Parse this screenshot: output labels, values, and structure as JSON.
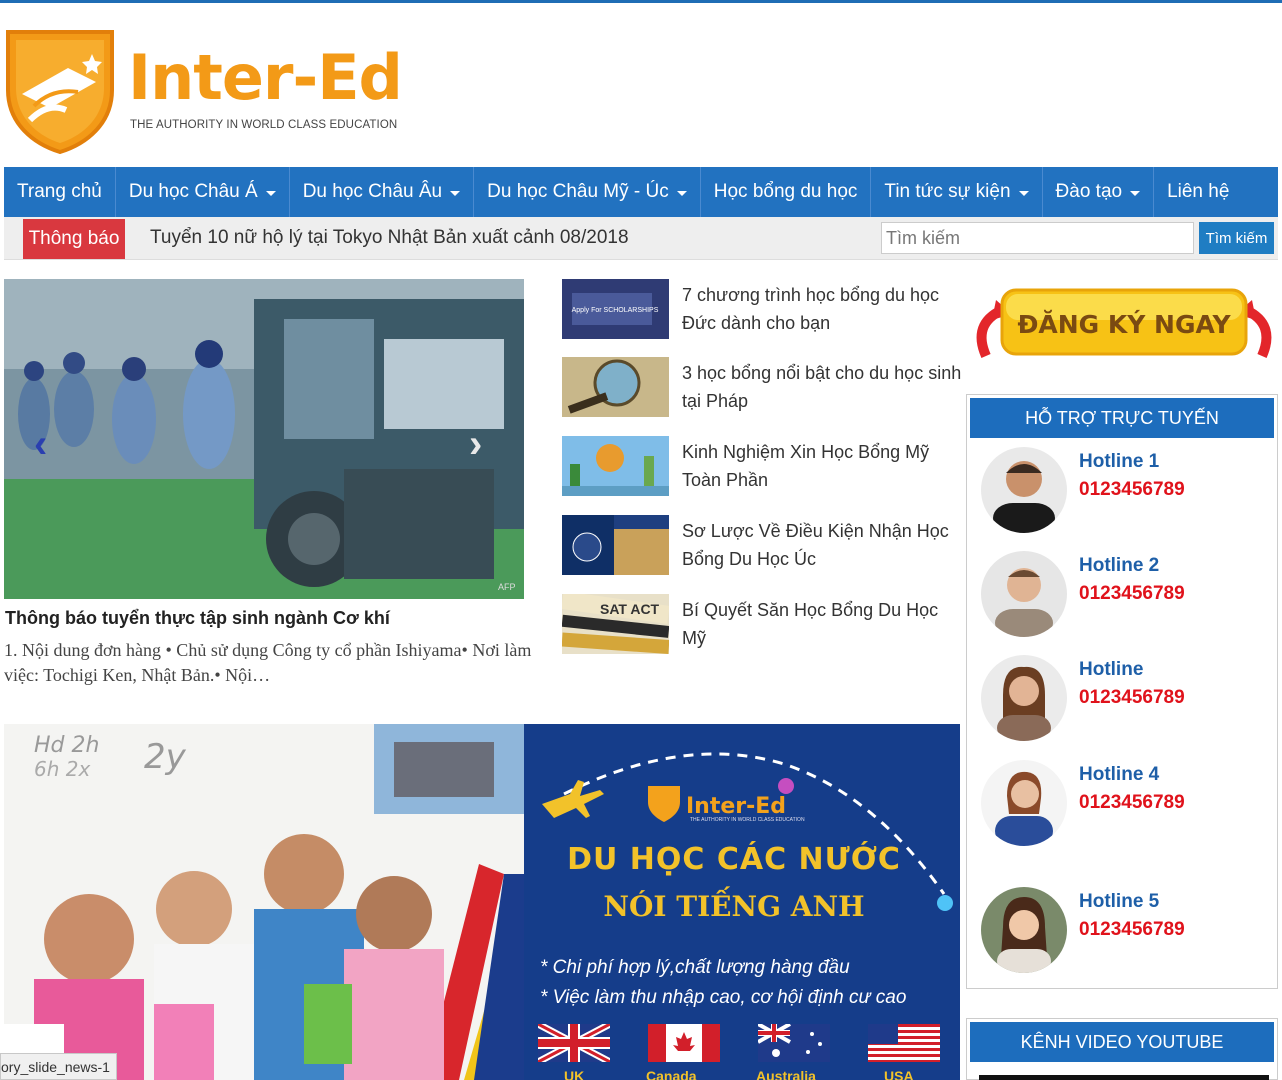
{
  "brand": {
    "name": "Inter-Ed",
    "tagline": "THE AUTHORITY IN WORLD CLASS EDUCATION",
    "color_primary": "#f39a17",
    "color_nav": "#2272c0"
  },
  "nav": {
    "items": [
      {
        "label": "Trang chủ",
        "dropdown": false
      },
      {
        "label": "Du học Châu Á",
        "dropdown": true
      },
      {
        "label": "Du học Châu Âu",
        "dropdown": true
      },
      {
        "label": "Du học Châu Mỹ - Úc",
        "dropdown": true
      },
      {
        "label": "Học bổng du học",
        "dropdown": false
      },
      {
        "label": "Tin tức sự kiện",
        "dropdown": true
      },
      {
        "label": "Đào tạo",
        "dropdown": true
      },
      {
        "label": "Liên hệ",
        "dropdown": false
      }
    ]
  },
  "notice": {
    "label": "Thông báo",
    "text": "Tuyển 10 nữ hộ lý tại Tokyo Nhật Bản xuất cảnh 08/2018"
  },
  "search": {
    "placeholder": "Tìm kiếm",
    "value": "",
    "button_label": "Tìm kiếm"
  },
  "slider": {
    "image_credit": "AFP",
    "title": "Thông báo tuyển thực tập sinh ngành Cơ khí",
    "description": "1. Nội dung đơn hàng • Chủ sử dụng Công ty cổ phần Ishiyama• Nơi làm việc: Tochigi Ken, Nhật Bản.• Nội…",
    "prev_icon": "chevron-left-icon",
    "next_icon": "chevron-right-icon"
  },
  "news": [
    {
      "title": "7 chương trình học bổng du học Đức dành cho bạn",
      "thumb_caption": "Apply For SCHOLARSHIPS"
    },
    {
      "title": "3 học bổng nổi bật cho du học sinh tại Pháp"
    },
    {
      "title": "Kinh Nghiệm Xin Học Bổng Mỹ Toàn Phần"
    },
    {
      "title": "Sơ Lược Về Điều Kiện Nhận Học Bổng Du Học Úc"
    },
    {
      "title": "Bí Quyết Săn Học Bổng Du Học Mỹ",
      "thumb_caption": "SAT ACT"
    }
  ],
  "banner": {
    "logo": "Inter-Ed",
    "logo_tag": "THE AUTHORITY IN WORLD CLASS EDUCATION",
    "heading1": "DU HỌC CÁC NƯỚC",
    "heading2": "NÓI TIẾNG ANH",
    "line1": "* Chi phí hợp lý,chất lượng hàng đầu",
    "line2": "* Việc làm thu nhập cao, cơ hội định cư cao",
    "flags": [
      {
        "label": "UK"
      },
      {
        "label": "Canada"
      },
      {
        "label": "Australia"
      },
      {
        "label": "USA"
      }
    ]
  },
  "status_tooltip": "ory_slide_news-1",
  "sidebar": {
    "register_label": "ĐĂNG KÝ NGAY",
    "support_title": "HỖ TRỢ TRỰC TUYẾN",
    "hotlines": [
      {
        "name": "Hotline 1",
        "phone": "0123456789"
      },
      {
        "name": "Hotline 2",
        "phone": "0123456789"
      },
      {
        "name": "Hotline",
        "phone": "0123456789"
      },
      {
        "name": "Hotline 4",
        "phone": "0123456789"
      },
      {
        "name": "Hotline 5",
        "phone": "0123456789"
      }
    ],
    "youtube_title": "KÊNH VIDEO YOUTUBE"
  }
}
